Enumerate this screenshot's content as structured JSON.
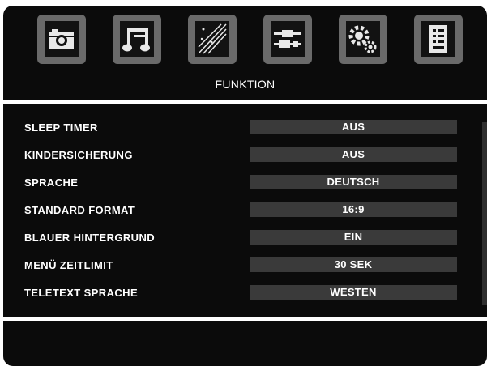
{
  "header": {
    "title": "FUNKTION",
    "icons": [
      {
        "name": "picture-icon"
      },
      {
        "name": "sound-icon"
      },
      {
        "name": "channel-icon"
      },
      {
        "name": "connection-icon"
      },
      {
        "name": "settings-icon"
      },
      {
        "name": "function-icon",
        "selected": true
      }
    ]
  },
  "settings": [
    {
      "label": "SLEEP TIMER",
      "value": "AUS"
    },
    {
      "label": "KINDERSICHERUNG",
      "value": "AUS"
    },
    {
      "label": "SPRACHE",
      "value": "DEUTSCH"
    },
    {
      "label": "STANDARD FORMAT",
      "value": "16:9"
    },
    {
      "label": "BLAUER HINTERGRUND",
      "value": "EIN"
    },
    {
      "label": "MENÜ ZEITLIMIT",
      "value": "30 SEK"
    },
    {
      "label": "TELETEXT SPRACHE",
      "value": "WESTEN"
    }
  ]
}
